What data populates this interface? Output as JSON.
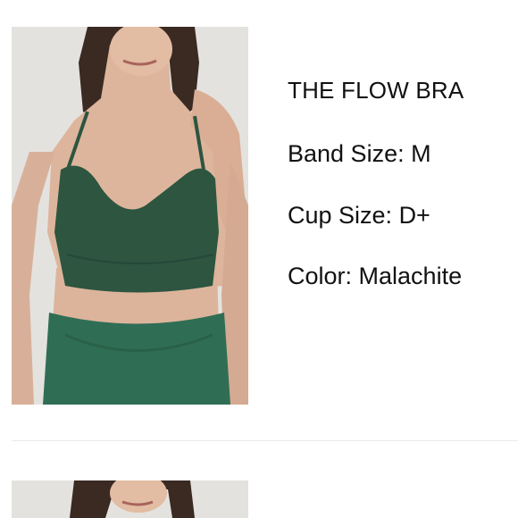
{
  "items": [
    {
      "image_alt": "Model wearing green sports bra and leggings",
      "title": "THE FLOW BRA",
      "attributes": [
        {
          "label": "Band Size:",
          "value": "M"
        },
        {
          "label": "Cup Size:",
          "value": "D+"
        },
        {
          "label": "Color:",
          "value": "Malachite"
        }
      ]
    },
    {
      "image_alt": "Model wearing green sports bra"
    }
  ],
  "colors": {
    "bra": "#2d5540",
    "leggings": "#2f6e55",
    "skin": "#ddb59c",
    "hair": "#3a2a22",
    "background": "#e4e2df",
    "divider": "#e9e9e9"
  }
}
